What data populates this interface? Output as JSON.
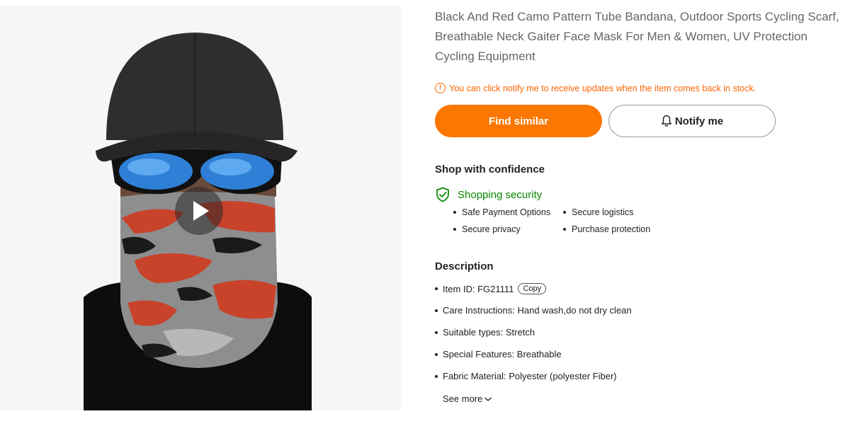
{
  "product": {
    "title": "Black And Red Camo Pattern Tube Bandana, Outdoor Sports Cycling Scarf, Breathable Neck Gaiter Face Mask For Men & Women, UV Protection Cycling Equipment",
    "image_icon": "play-icon"
  },
  "notice": {
    "icon": "exclamation-circle-icon",
    "text": "You can click notify me to receive updates when the item comes back in stock."
  },
  "buttons": {
    "find_similar": "Find similar",
    "notify_me": "Notify me",
    "notify_icon": "bell-icon"
  },
  "confidence": {
    "heading": "Shop with confidence",
    "security_label": "Shopping security",
    "security_icon": "shield-check-icon",
    "items": [
      "Safe Payment Options",
      "Secure logistics",
      "Secure privacy",
      "Purchase protection"
    ]
  },
  "description": {
    "heading": "Description",
    "item_id_label": "Item ID: FG21111",
    "copy_label": "Copy",
    "items": [
      "Care Instructions: Hand wash,do not dry clean",
      "Suitable types: Stretch",
      "Special Features: Breathable",
      "Fabric Material: Polyester (polyester Fiber)"
    ],
    "see_more": "See more"
  },
  "colors": {
    "accent": "#fb7701",
    "notice": "#fa6400",
    "security": "#0a8800"
  }
}
